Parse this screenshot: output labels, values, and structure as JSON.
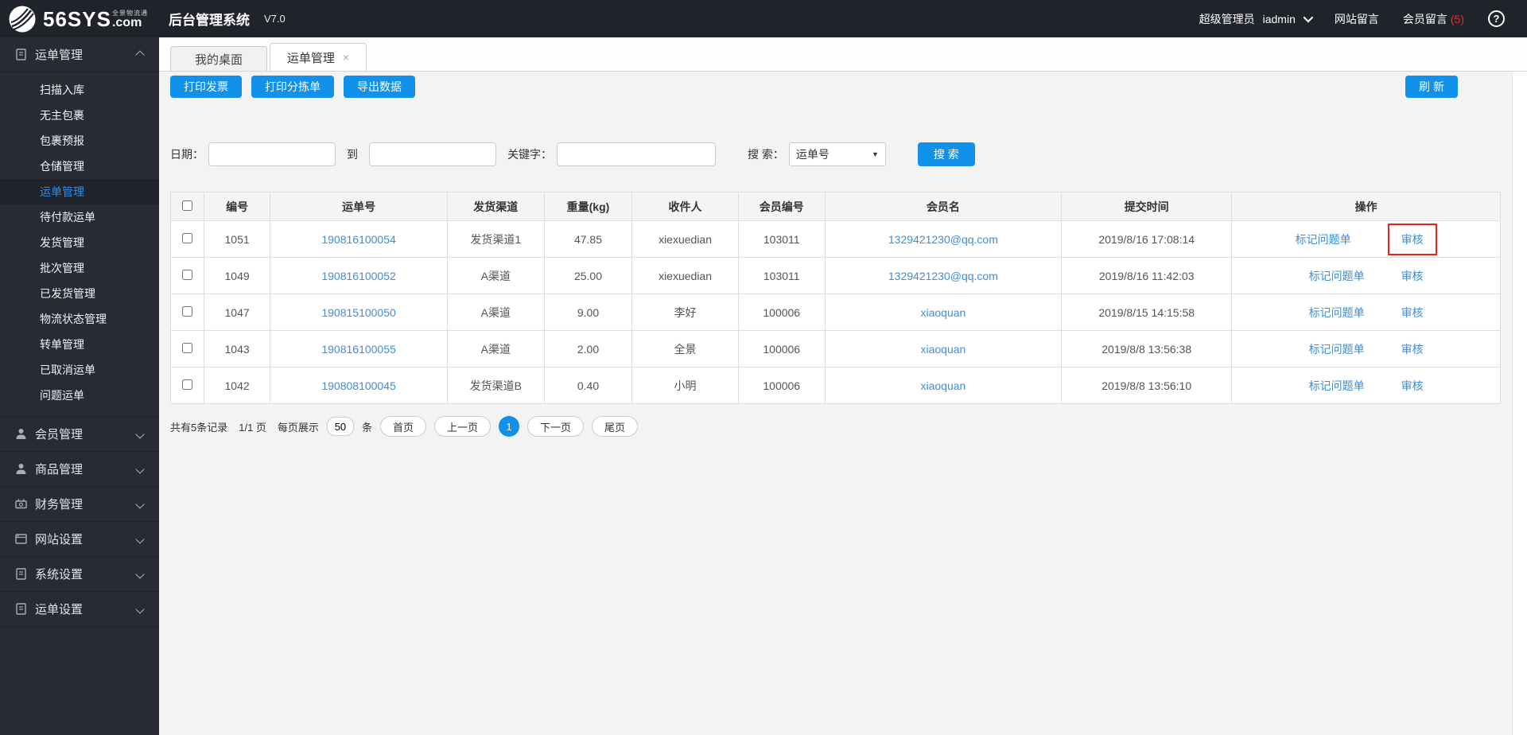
{
  "topbar": {
    "logo_main": "56SYS",
    "logo_dotcom": ".com",
    "logo_tagline": "全景物流通",
    "app_title": "后台管理系统",
    "version": "V7.0",
    "role": "超级管理员",
    "username": "iadmin",
    "site_messages": "网站留言",
    "member_messages": "会员留言",
    "member_messages_count": "(5)"
  },
  "icons": {
    "help": "?",
    "tab_close": "×",
    "select_caret": "▼"
  },
  "sidebar": {
    "waybill_section": "运单管理",
    "waybill_items": [
      "扫描入库",
      "无主包裹",
      "包裹预报",
      "仓储管理",
      "运单管理",
      "待付款运单",
      "发货管理",
      "批次管理",
      "已发货管理",
      "物流状态管理",
      "转单管理",
      "已取消运单",
      "问题运单"
    ],
    "active_item": "运单管理",
    "sections": [
      "会员管理",
      "商品管理",
      "财务管理",
      "网站设置",
      "系统设置",
      "运单设置"
    ]
  },
  "tabs": {
    "desktop": "我的桌面",
    "waybill": "运单管理"
  },
  "toolbar": {
    "print_invoice": "打印发票",
    "print_sorting": "打印分拣单",
    "export_data": "导出数据",
    "refresh": "刷 新"
  },
  "search": {
    "date_label": "日期：",
    "to_label": "到",
    "keyword_label": "关键字：",
    "search_by_label": "搜 索：",
    "search_by_value": "运单号",
    "search_button": "搜 索"
  },
  "table": {
    "headers": [
      "编号",
      "运单号",
      "发货渠道",
      "重量(kg)",
      "收件人",
      "会员编号",
      "会员名",
      "提交时间",
      "操作"
    ],
    "op_mark": "标记问题单",
    "op_audit": "审核",
    "rows": [
      {
        "id": "1051",
        "waybill_no": "190816100054",
        "channel": "发货渠道1",
        "weight": "47.85",
        "recipient": "xiexuedian",
        "member_no": "103011",
        "member_name": "1329421230@qq.com",
        "submitted": "2019/8/16 17:08:14"
      },
      {
        "id": "1049",
        "waybill_no": "190816100052",
        "channel": "A渠道",
        "weight": "25.00",
        "recipient": "xiexuedian",
        "member_no": "103011",
        "member_name": "1329421230@qq.com",
        "submitted": "2019/8/16 11:42:03"
      },
      {
        "id": "1047",
        "waybill_no": "190815100050",
        "channel": "A渠道",
        "weight": "9.00",
        "recipient": "李好",
        "member_no": "100006",
        "member_name": "xiaoquan",
        "submitted": "2019/8/15 14:15:58"
      },
      {
        "id": "1043",
        "waybill_no": "190816100055",
        "channel": "A渠道",
        "weight": "2.00",
        "recipient": "全景",
        "member_no": "100006",
        "member_name": "xiaoquan",
        "submitted": "2019/8/8 13:56:38"
      },
      {
        "id": "1042",
        "waybill_no": "190808100045",
        "channel": "发货渠道B",
        "weight": "0.40",
        "recipient": "小明",
        "member_no": "100006",
        "member_name": "xiaoquan",
        "submitted": "2019/8/8 13:56:10"
      }
    ]
  },
  "pagination": {
    "total_text": "共有5条记录",
    "page_text": "1/1 页",
    "per_page_label": "每页展示",
    "per_page_value": "50",
    "unit_label": "条",
    "first": "首页",
    "prev": "上一页",
    "current": "1",
    "next": "下一页",
    "last": "尾页"
  },
  "colors": {
    "accent_blue": "#1191e9",
    "link_blue": "#3e8ed8",
    "alert_red": "#ef2b2b",
    "highlight_box_red": "#e8231d"
  }
}
